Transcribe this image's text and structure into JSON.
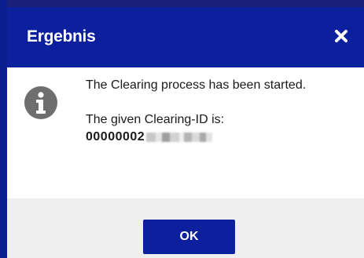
{
  "dialog": {
    "title": "Ergebnis",
    "close_icon": "close-icon",
    "info_icon": "info-icon",
    "message_line1": "The Clearing process has been started.",
    "message_line2": "The given Clearing-ID is:",
    "clearing_id_visible": "00000002",
    "ok_label": "OK"
  },
  "colors": {
    "title_bar": "#0c1f9c",
    "button": "#0c1f9c",
    "footer": "#efefef",
    "icon_gray": "#6e6e6e"
  }
}
